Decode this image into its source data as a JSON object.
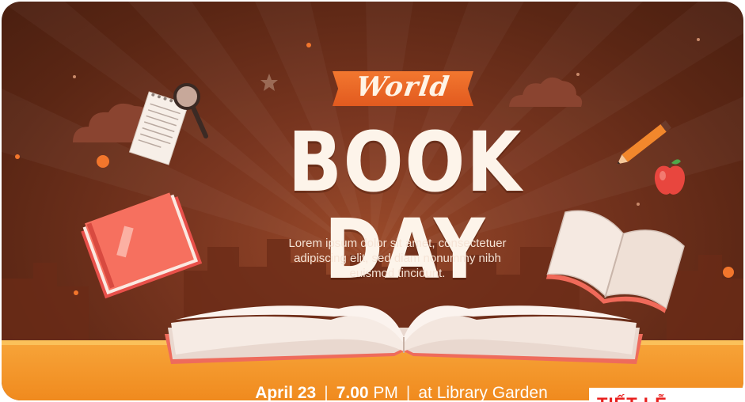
{
  "banner": {
    "ribbon_text": "World",
    "title": "BOOK DAY",
    "description_lines": [
      "Lorem ipsum dolor sit amet, consectetuer",
      "adipiscing elit, sed diam nonummy nibh",
      "euismod tincidunt."
    ],
    "footer": {
      "date": "April 23",
      "separator": "|",
      "time_number": "7.00",
      "time_suffix": "PM",
      "location": "at Library Garden"
    }
  },
  "watermark": {
    "text": "TIẾT LỄ"
  },
  "colors": {
    "background_dark": "#5a2614",
    "background_mid": "#9a4a2a",
    "ribbon": "#e25a1f",
    "floor": "#f08a1e",
    "title_text": "#fdf4ea",
    "book_red": "#f06a5a",
    "watermark_red": "#e8201e"
  },
  "icons": [
    "cloud-icon",
    "notepad-icon",
    "magnifier-icon",
    "star-icon",
    "pencil-icon",
    "apple-icon",
    "red-book-icon",
    "open-book-icon",
    "large-open-book-icon",
    "city-skyline"
  ]
}
